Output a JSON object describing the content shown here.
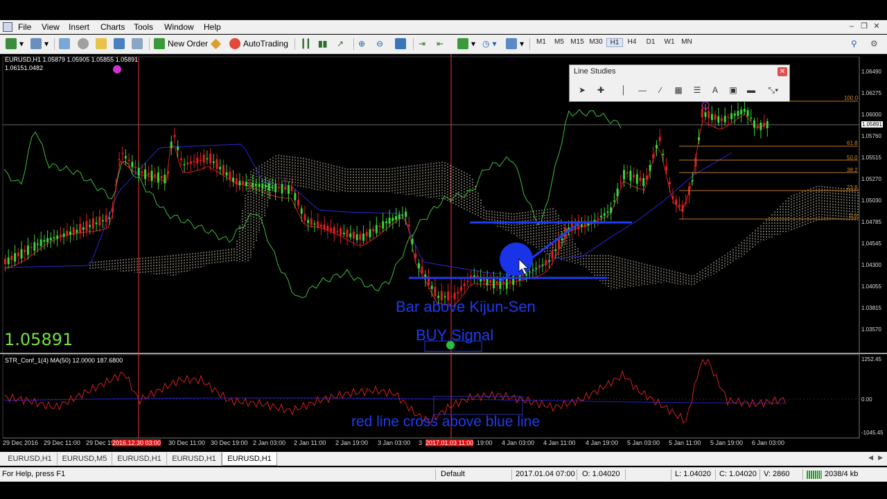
{
  "menu": [
    "File",
    "View",
    "Insert",
    "Charts",
    "Tools",
    "Window",
    "Help"
  ],
  "toolbar": {
    "new_order": "New Order",
    "auto_trading": "AutoTrading",
    "timeframes": [
      "M1",
      "M5",
      "M15",
      "M30",
      "H1",
      "H4",
      "D1",
      "W1",
      "MN"
    ]
  },
  "chart": {
    "header_line1": "EURUSD,H1  1.05879 1.05905 1.05855 1.05891",
    "header_line2": "1.06151.0482",
    "big_price": "1.05891",
    "price_labels": [
      "1.06490",
      "1.06275",
      "1.06000",
      "1.05891",
      "1.05760",
      "1.05515",
      "1.05270",
      "1.05030",
      "1.04785",
      "1.04545",
      "1.04300",
      "1.04055",
      "1.03815",
      "1.03570"
    ],
    "fib_labels": [
      "100.0",
      "61.8",
      "50.0",
      "38.2",
      "23.6",
      "0.0"
    ],
    "annotation_kijun": "Bar above Kijun-Sen",
    "annotation_buy": "BUY Signal",
    "indicator_header": "STR_Conf_1(4) MA(50) 12.0000 187.6800",
    "indicator_levels": [
      "1252.45",
      "0.00",
      "-1045.45"
    ],
    "annotation_cross": "red line cross above blue line",
    "time_labels": [
      "29 Dec 2016",
      "29 Dec 11:00",
      "29 Dec 19",
      "2016.12.30 03:00",
      "30 Dec 11:00",
      "30 Dec 19:00",
      "2 Jan 03:00",
      "2 Jan 11:00",
      "2 Jan 19:00",
      "3 Jan 03:00",
      "3",
      "2017.01.03 11:00",
      "19:00",
      "4 Jan 03:00",
      "4 Jan 11:00",
      "4 Jan 19:00",
      "5 Jan 03:00",
      "5 Jan 11:00",
      "5 Jan 19:00",
      "6 Jan 03:00"
    ]
  },
  "line_studies": {
    "title": "Line Studies"
  },
  "tabs": [
    "EURUSD,H1",
    "EURUSD,M5",
    "EURUSD,H1",
    "EURUSD,H1",
    "EURUSD,H1"
  ],
  "status": {
    "help": "For Help, press F1",
    "profile": "Default",
    "datetime": "2017.01.04 07:00",
    "open": "O: 1.04020",
    "low": "L: 1.04020",
    "close": "C: 1.04020",
    "volume": "V: 2860",
    "traffic": "2038/4 kb"
  }
}
